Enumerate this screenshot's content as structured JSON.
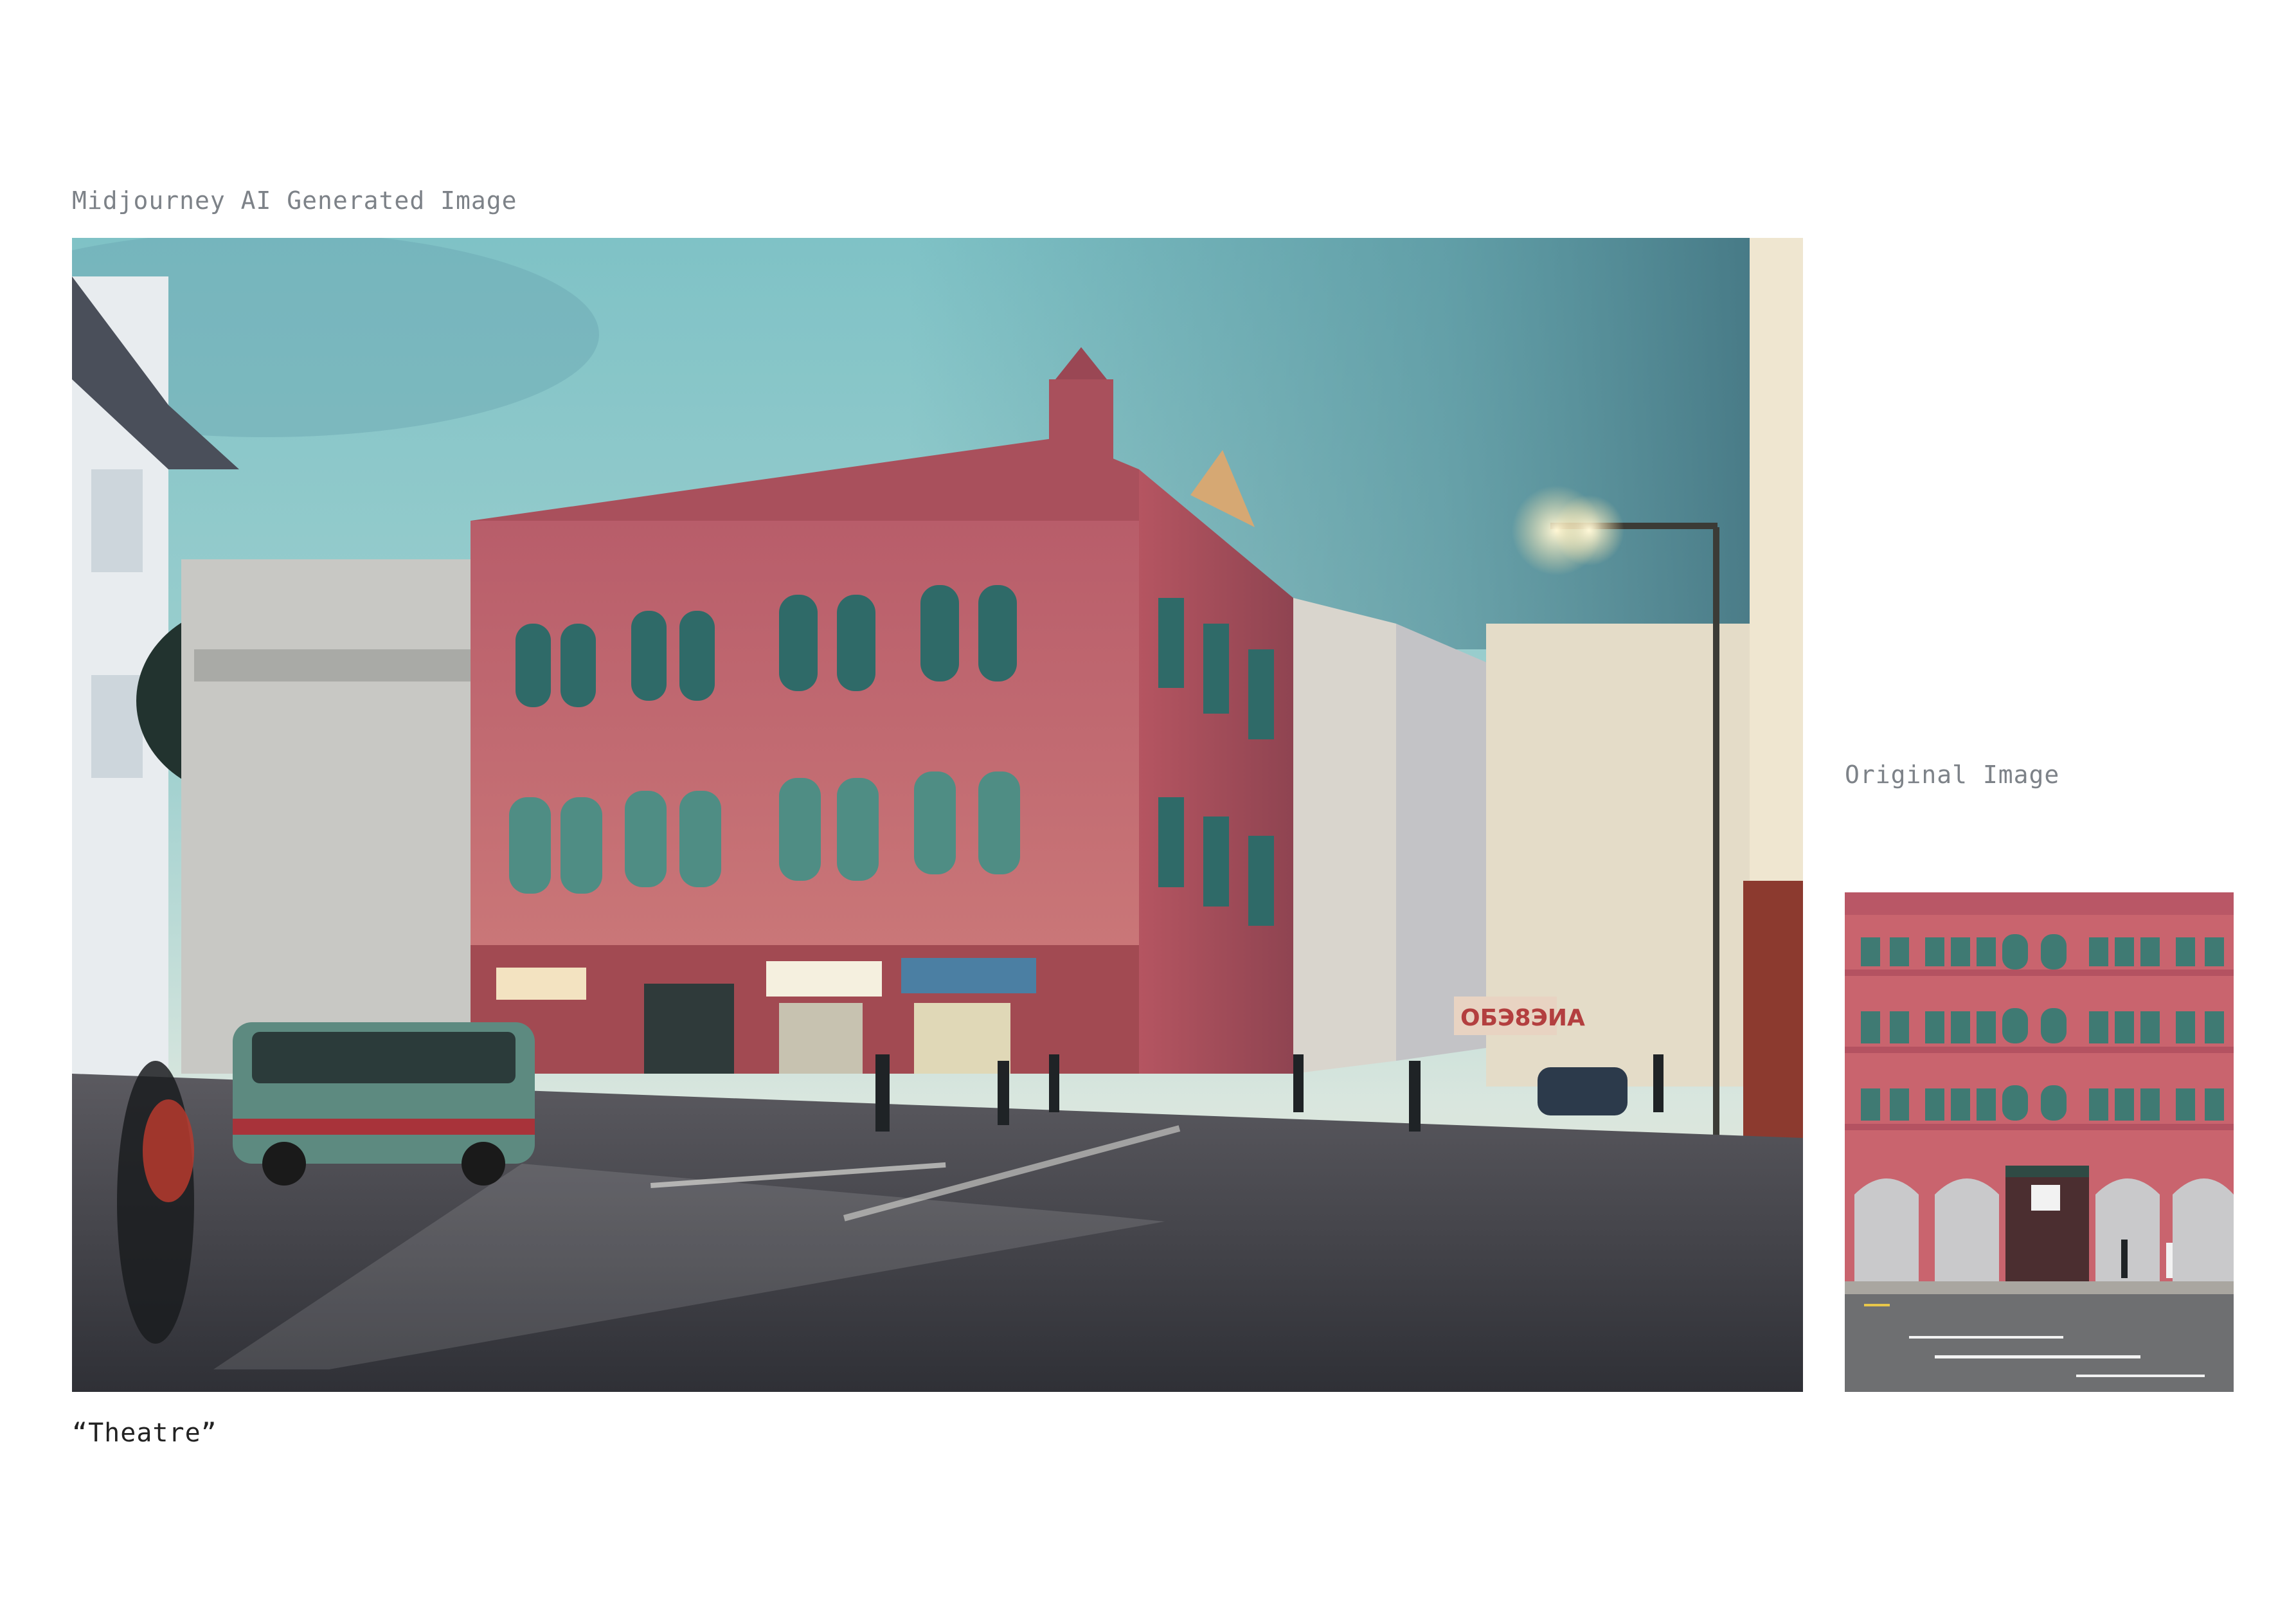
{
  "labels": {
    "ai_caption": "Midjourney AI Generated Image",
    "original_caption": "Original Image",
    "title_quote": "“Theatre”"
  },
  "images": {
    "ai_image": {
      "description": "Photo of pink colonial shophouse building on street corner at dusk",
      "sign_texts": [
        "ОБЭ8ЭИА"
      ]
    },
    "original_image": {
      "description": "Photo of pink colonial building facade with arches"
    }
  },
  "colors": {
    "caption_grey": "#7d8288",
    "quote_text": "#222222",
    "building_pink": "#c9646e",
    "shutter_green": "#3f7a73",
    "sky_teal": "#8fc9cc"
  }
}
